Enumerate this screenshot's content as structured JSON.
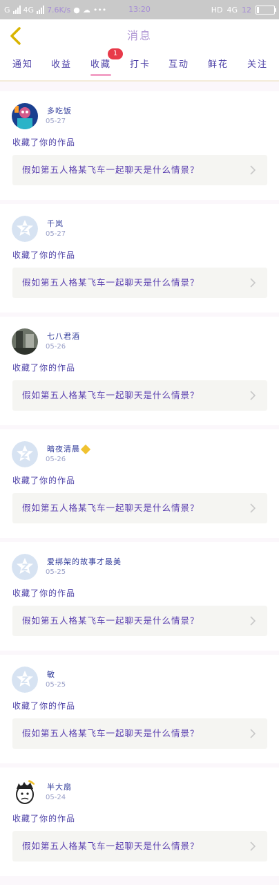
{
  "status_bar": {
    "carrier": "G",
    "network": "4G",
    "speed": "7.6K/s",
    "time": "13:20",
    "right_label": "HD",
    "network_right": "4G",
    "battery_pct": "12"
  },
  "header": {
    "title": "消息"
  },
  "tabs": [
    {
      "label": "通知"
    },
    {
      "label": "收益"
    },
    {
      "label": "收藏"
    },
    {
      "label": "打卡"
    },
    {
      "label": "互动"
    },
    {
      "label": "鲜花"
    },
    {
      "label": "关注"
    }
  ],
  "tab_badge": "1",
  "notifications": [
    {
      "user": "多吃饭",
      "date": "05-27",
      "action": "收藏了你的作品",
      "post": "假如第五人格某飞车一起聊天是什么情景？",
      "avatar": "colorful"
    },
    {
      "user": "千岚",
      "date": "05-27",
      "action": "收藏了你的作品",
      "post": "假如第五人格某飞车一起聊天是什么情景？",
      "avatar": "default"
    },
    {
      "user": "七八君酒",
      "date": "05-26",
      "action": "收藏了你的作品",
      "post": "假如第五人格某飞车一起聊天是什么情景？",
      "avatar": "photo"
    },
    {
      "user": "暗夜清晨",
      "date": "05-26",
      "action": "收藏了你的作品",
      "post": "假如第五人格某飞车一起聊天是什么情景？",
      "avatar": "default",
      "vip": true
    },
    {
      "user": "爱绑架的故事才最美",
      "date": "05-25",
      "action": "收藏了你的作品",
      "post": "假如第五人格某飞车一起聊天是什么情景？",
      "avatar": "default"
    },
    {
      "user": "敏",
      "date": "05-25",
      "action": "收藏了你的作品",
      "post": "假如第五人格某飞车一起聊天是什么情景？",
      "avatar": "default"
    },
    {
      "user": "半大扇",
      "date": "05-24",
      "action": "收藏了你的作品",
      "post": "假如第五人格某飞车一起聊天是什么情景？",
      "avatar": "cartoon"
    }
  ],
  "colors": {
    "accent": "#4b3fa6",
    "tab_underline": "#f2a1c6",
    "badge": "#e83a4a",
    "back_arrow": "#d9b400"
  }
}
